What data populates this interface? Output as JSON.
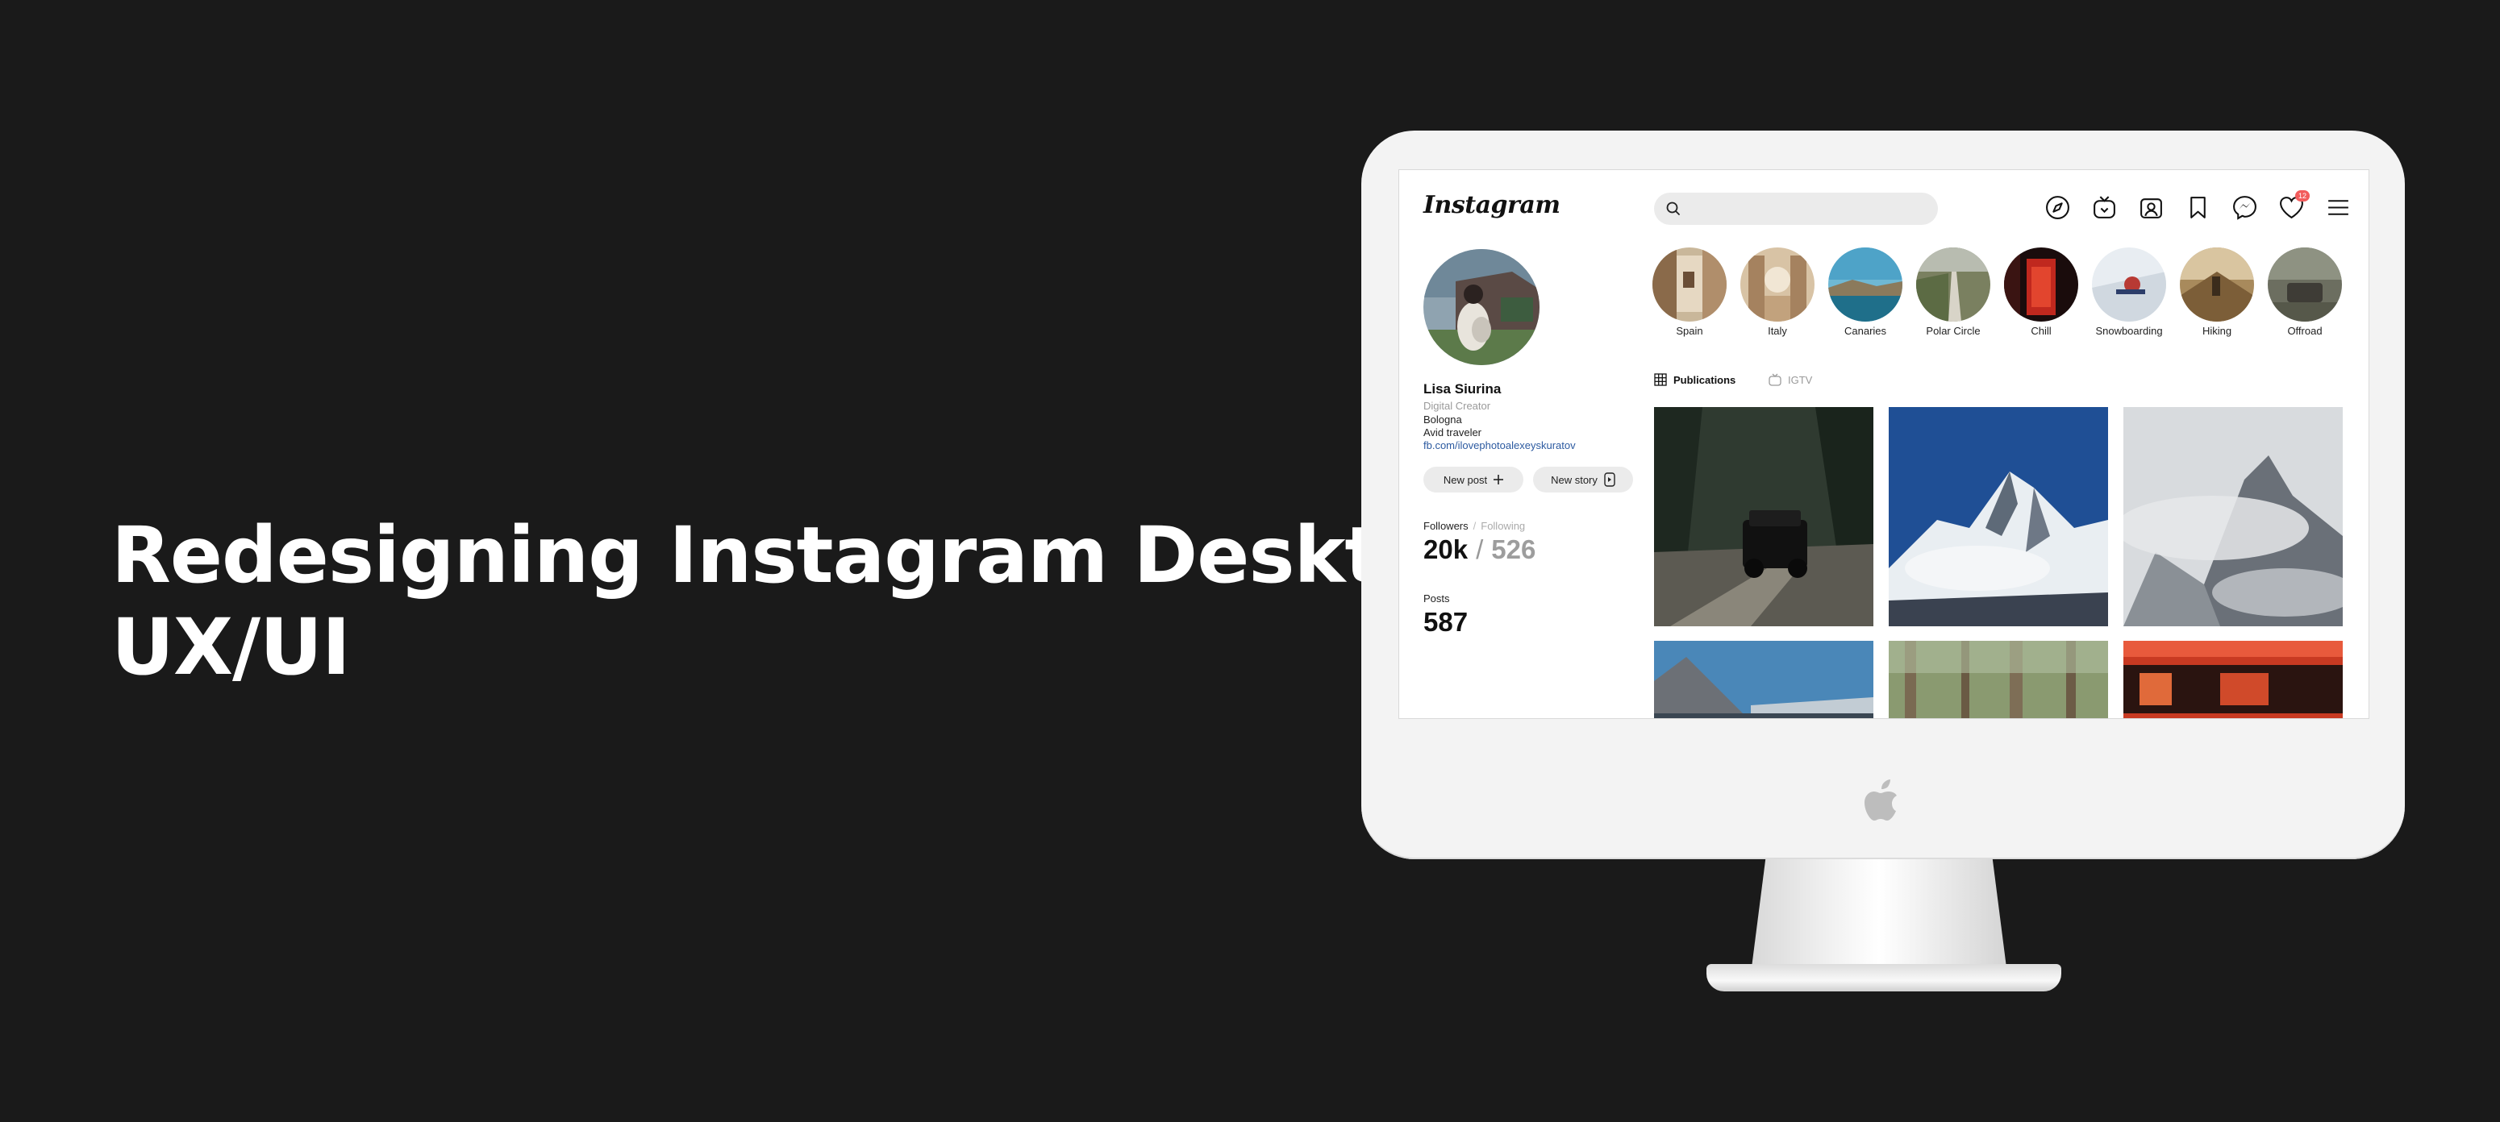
{
  "headline": {
    "line1": "Redesigning Instagram Desktop",
    "line2": "UX/UI"
  },
  "app": {
    "logo_text": "Instagram",
    "search": {
      "placeholder": "",
      "value": ""
    },
    "top_icons": [
      "compass-icon",
      "igtv-icon",
      "profile-icon",
      "bookmark-icon",
      "messenger-icon",
      "heart-icon",
      "menu-icon"
    ],
    "notification_count": "12"
  },
  "profile": {
    "name": "Lisa Siurina",
    "role": "Digital Creator",
    "bio_line1": "Bologna",
    "bio_line2": "Avid traveler",
    "link": "fb.com/ilovephotoalexeyskuratov",
    "new_post_label": "New post",
    "new_story_label": "New story",
    "followers_label": "Followers",
    "separator": "/",
    "following_label": "Following",
    "followers_count": "20k",
    "following_count": "526",
    "posts_label": "Posts",
    "posts_count": "587"
  },
  "stories": [
    {
      "label": "Spain"
    },
    {
      "label": "Italy"
    },
    {
      "label": "Canaries"
    },
    {
      "label": "Polar Circle"
    },
    {
      "label": "Chill"
    },
    {
      "label": "Snowboarding"
    },
    {
      "label": "Hiking"
    },
    {
      "label": "Offroad"
    }
  ],
  "tabs": {
    "publications": "Publications",
    "igtv": "IGTV"
  },
  "posts": [
    {
      "subject": "jeep on forest road"
    },
    {
      "subject": "snowy mountain peak"
    },
    {
      "subject": "misty mountains"
    },
    {
      "subject": "snowy ridge and sky"
    },
    {
      "subject": "forest trees"
    },
    {
      "subject": "neon sign"
    }
  ],
  "colors": {
    "background": "#1a1a1a",
    "link": "#2c5aa0",
    "badge": "#f25c5c"
  }
}
